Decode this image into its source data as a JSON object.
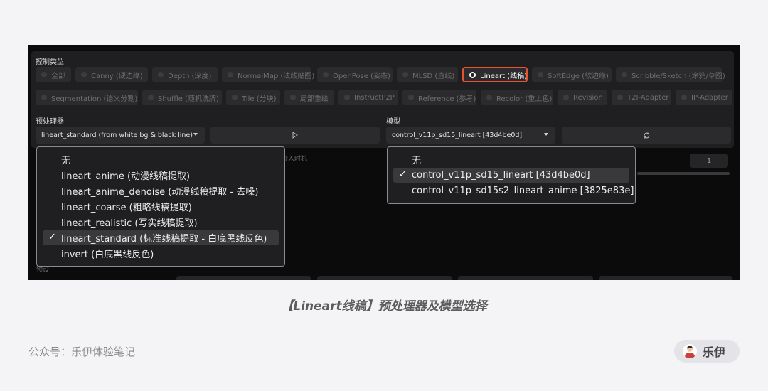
{
  "control_type_label": "控制类型",
  "control_types_row1": [
    {
      "label": "全部",
      "selected": false
    },
    {
      "label": "Canny (硬边缘)",
      "selected": false
    },
    {
      "label": "Depth (深度)",
      "selected": false
    },
    {
      "label": "NormalMap (法线贴图)",
      "selected": false
    },
    {
      "label": "OpenPose (姿态)",
      "selected": false
    },
    {
      "label": "MLSD (直线)",
      "selected": false
    },
    {
      "label": "Lineart (线稿)",
      "selected": true
    },
    {
      "label": "SoftEdge (软边缘)",
      "selected": false
    },
    {
      "label": "Scribble/Sketch (涂鸦/草图)",
      "selected": false
    }
  ],
  "control_types_row2": [
    {
      "label": "Segmentation (语义分割)",
      "selected": false
    },
    {
      "label": "Shuffle (随机洗牌)",
      "selected": false
    },
    {
      "label": "Tile (分块)",
      "selected": false
    },
    {
      "label": "局部重绘",
      "selected": false
    },
    {
      "label": "InstructP2P",
      "selected": false
    },
    {
      "label": "Reference (参考)",
      "selected": false
    },
    {
      "label": "Recolor (重上色)",
      "selected": false
    },
    {
      "label": "Revision",
      "selected": false
    },
    {
      "label": "T2I-Adapter",
      "selected": false
    },
    {
      "label": "IP-Adapter",
      "selected": false
    }
  ],
  "preprocessor": {
    "label": "预处理器",
    "value": "lineart_standard (from white bg & black line)",
    "run_icon": "play-triangle-icon"
  },
  "model": {
    "label": "模型",
    "value": "control_v11p_sd15_lineart [43d4be0d]",
    "refresh_icon": "refresh-icon"
  },
  "background_hints": {
    "partial_text": "介入时机",
    "number_value": "1",
    "preset_label": "预设"
  },
  "preprocessor_dropdown": {
    "options": [
      {
        "label": "无",
        "selected": false
      },
      {
        "label": "lineart_anime (动漫线稿提取)",
        "selected": false
      },
      {
        "label": "lineart_anime_denoise (动漫线稿提取 - 去噪)",
        "selected": false
      },
      {
        "label": "lineart_coarse (粗略线稿提取)",
        "selected": false
      },
      {
        "label": "lineart_realistic (写实线稿提取)",
        "selected": false
      },
      {
        "label": "lineart_standard (标准线稿提取 - 白底黑线反色)",
        "selected": true
      },
      {
        "label": "invert (白底黑线反色)",
        "selected": false
      }
    ],
    "check_mark": "✓"
  },
  "model_dropdown": {
    "options": [
      {
        "label": "无",
        "selected": false
      },
      {
        "label": "control_v11p_sd15_lineart [43d4be0d]",
        "selected": true
      },
      {
        "label": "control_v11p_sd15s2_lineart_anime [3825e83e]",
        "selected": false
      }
    ],
    "check_mark": "✓"
  },
  "caption": "【Lineart线稿】预处理器及模型选择",
  "footer": {
    "account_text": "公众号：乐伊体验笔记",
    "author_name": "乐伊"
  },
  "colors": {
    "selected_border": "#e8532f",
    "panel_bg": "#1f1f21",
    "screenshot_bg": "#0b0b0c",
    "page_bg": "#f4f4f6"
  }
}
